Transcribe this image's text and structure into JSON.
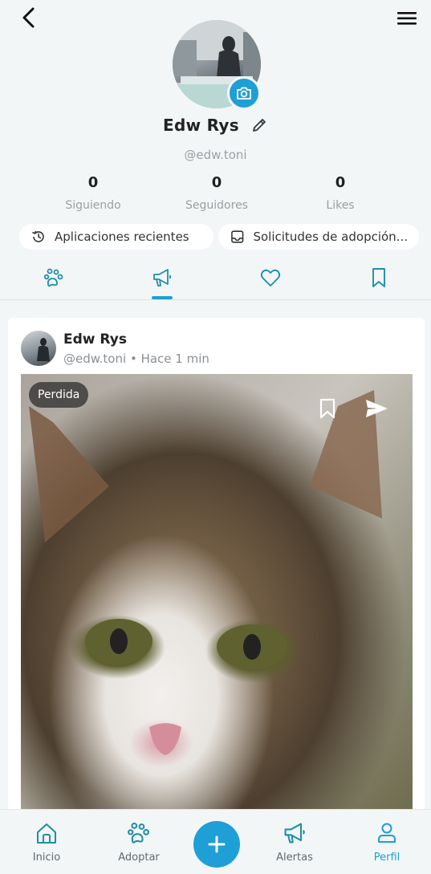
{
  "header": {
    "back_icon": "arrow-back-icon",
    "menu_icon": "hamburger-menu-icon"
  },
  "profile": {
    "name": "Edw Rys",
    "handle": "@edw.toni",
    "camera_icon": "camera-icon",
    "edit_icon": "pencil-icon",
    "stats": [
      {
        "value": "0",
        "label": "Siguiendo"
      },
      {
        "value": "0",
        "label": "Seguidores"
      },
      {
        "value": "0",
        "label": "Likes"
      }
    ]
  },
  "chips": {
    "recent": {
      "label": "Aplicaciones recientes",
      "icon": "history-icon"
    },
    "requests": {
      "label": "Solicitudes de adopción...",
      "icon": "inbox-icon"
    }
  },
  "tabs": [
    {
      "icon": "paw-icon",
      "active": false
    },
    {
      "icon": "megaphone-icon",
      "active": true
    },
    {
      "icon": "heart-icon",
      "active": false
    },
    {
      "icon": "bookmark-icon",
      "active": false
    }
  ],
  "post": {
    "author": "Edw Rys",
    "handle": "@edw.toni",
    "separator": "•",
    "time": "Hace 1 min",
    "badge": "Perdida",
    "save_icon": "bookmark-icon",
    "share_icon": "send-icon"
  },
  "bottom_nav": {
    "items": [
      {
        "label": "Inicio",
        "icon": "home-icon"
      },
      {
        "label": "Adoptar",
        "icon": "paw-icon"
      },
      {
        "label": "",
        "icon": "plus-icon"
      },
      {
        "label": "Alertas",
        "icon": "megaphone-icon"
      },
      {
        "label": "Perfil",
        "icon": "user-icon"
      }
    ],
    "active": "Perfil"
  },
  "colors": {
    "accent": "#1e9fd6",
    "background": "#f3f6f7",
    "muted_text": "#9aa0a4"
  }
}
